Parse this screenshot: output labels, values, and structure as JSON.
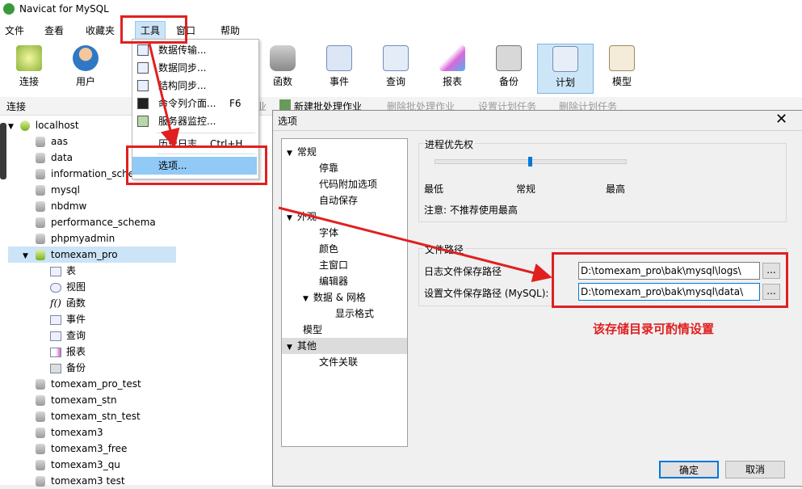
{
  "app": {
    "title": "Navicat for MySQL"
  },
  "menubar": {
    "items": [
      "文件",
      "查看",
      "收藏夹",
      "工具",
      "窗口",
      "帮助"
    ]
  },
  "toolbar": {
    "buttons": [
      "连接",
      "用户",
      "函数",
      "事件",
      "查询",
      "报表",
      "备份",
      "计划",
      "模型"
    ]
  },
  "subbar": {
    "left_label": "连接",
    "actions": [
      "业",
      "新建批处理作业",
      "删除批处理作业",
      "设置计划任务",
      "删除计划任务"
    ]
  },
  "sidebar": {
    "connection": "localhost",
    "databases": [
      "aas",
      "data",
      "information_sche",
      "mysql",
      "nbdmw",
      "performance_schema",
      "phpmyadmin",
      "tomexam_pro"
    ],
    "objects": [
      "表",
      "视图",
      "函数",
      "事件",
      "查询",
      "报表",
      "备份"
    ],
    "more_databases": [
      "tomexam_pro_test",
      "tomexam_stn",
      "tomexam_stn_test",
      "tomexam3",
      "tomexam3_free",
      "tomexam3_qu",
      "tomexam3 test"
    ]
  },
  "tools_menu": {
    "items": [
      {
        "label": "数据传输...",
        "shortcut": ""
      },
      {
        "label": "数据同步...",
        "shortcut": ""
      },
      {
        "label": "结构同步...",
        "shortcut": ""
      },
      {
        "label": "命令列介面...",
        "shortcut": "F6"
      },
      {
        "label": "服务器监控...",
        "shortcut": ""
      },
      {
        "label": "历史日志...",
        "shortcut": "Ctrl+H"
      },
      {
        "label": "选项...",
        "shortcut": ""
      }
    ]
  },
  "options_dialog": {
    "title": "选项",
    "close": "✕",
    "nav": {
      "general": "常规",
      "general_children": [
        "停靠",
        "代码附加选项",
        "自动保存"
      ],
      "appearance": "外观",
      "appearance_children": [
        "字体",
        "颜色",
        "主窗口",
        "编辑器"
      ],
      "data_grid": "数据 & 网格",
      "data_grid_children": [
        "显示格式"
      ],
      "model": "模型",
      "other": "其他",
      "other_children": [
        "文件关联"
      ]
    },
    "priority": {
      "title": "进程优先权",
      "low": "最低",
      "normal": "常规",
      "high": "最高",
      "note": "注意: 不推荐使用最高",
      "level": 0.5
    },
    "paths": {
      "title": "文件路径",
      "log_label": "日志文件保存路径",
      "log_value": "D:\\tomexam_pro\\bak\\mysql\\logs\\",
      "settings_label": "设置文件保存路径 (MySQL):",
      "settings_value": "D:\\tomexam_pro\\bak\\mysql\\data\\",
      "browse": "..."
    },
    "ok": "确定",
    "cancel": "取消"
  },
  "annotation": {
    "text": "该存储目录可酌情设置",
    "color": "#e02020"
  }
}
